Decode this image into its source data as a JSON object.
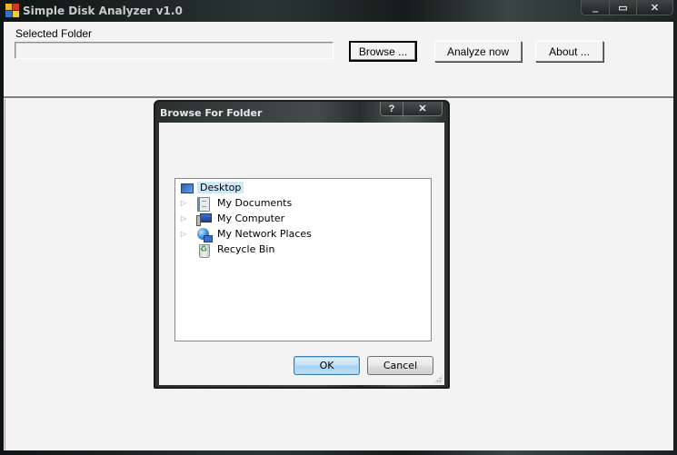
{
  "window": {
    "title": "Simple Disk Analyzer v1.0",
    "caption_buttons": {
      "minimize": "‗",
      "maximize": "▭",
      "close": "✕"
    }
  },
  "main": {
    "selected_folder_label": "Selected Folder",
    "selected_folder_value": "",
    "buttons": {
      "browse": "Browse ...",
      "analyze": "Analyze now",
      "about": "About ..."
    }
  },
  "dialog": {
    "title": "Browse For Folder",
    "help_glyph": "?",
    "close_glyph": "✕",
    "tree": [
      {
        "label": "Desktop",
        "icon": "desktop-icon",
        "expander": false,
        "selected": true
      },
      {
        "label": "My Documents",
        "icon": "my-documents-icon",
        "expander": true,
        "selected": false
      },
      {
        "label": "My Computer",
        "icon": "my-computer-icon",
        "expander": true,
        "selected": false
      },
      {
        "label": "My Network Places",
        "icon": "network-places-icon",
        "expander": true,
        "selected": false
      },
      {
        "label": "Recycle Bin",
        "icon": "recycle-bin-icon",
        "expander": false,
        "selected": false
      }
    ],
    "expander_glyph": "▷",
    "ok_label": "OK",
    "cancel_label": "Cancel"
  }
}
